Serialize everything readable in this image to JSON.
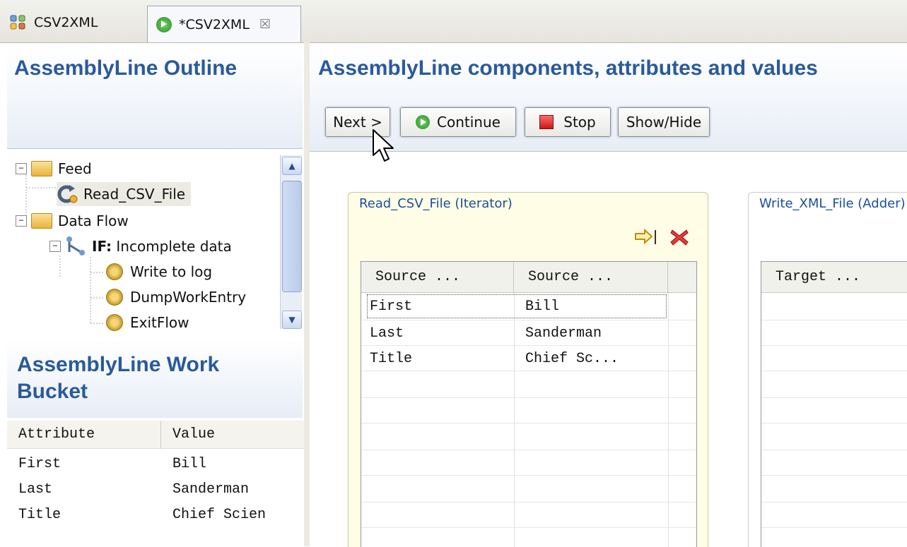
{
  "tabs": [
    {
      "label": "CSV2XML",
      "icon": "components-icon"
    },
    {
      "label": "*CSV2XML",
      "icon": "run-icon",
      "close": "☒"
    }
  ],
  "outline": {
    "title": "AssemblyLine Outline",
    "tree": {
      "feed": {
        "label": "Feed",
        "expander": "−"
      },
      "read_csv": {
        "label": "Read_CSV_File"
      },
      "dataflow": {
        "label": "Data Flow",
        "expander": "−"
      },
      "if_node": {
        "prefix": "IF:",
        "label": " Incomplete data",
        "expander": "−"
      },
      "write_log": {
        "label": "Write to log"
      },
      "dump": {
        "label": "DumpWorkEntry"
      },
      "exit": {
        "label": "ExitFlow"
      }
    }
  },
  "bucket": {
    "title": "AssemblyLine Work Bucket",
    "headers": [
      "Attribute",
      "Value"
    ],
    "rows": [
      [
        "First",
        "Bill"
      ],
      [
        "Last",
        "Sanderman"
      ],
      [
        "Title",
        "Chief Scien"
      ]
    ]
  },
  "main": {
    "title": "AssemblyLine components, attributes and values",
    "buttons": {
      "next": "Next >",
      "continue": "Continue",
      "stop": "Stop",
      "showhide": "Show/Hide"
    }
  },
  "components": [
    {
      "label": "Read_CSV_File (Iterator)",
      "headers": [
        "Source ...",
        "Source ..."
      ],
      "rows": [
        [
          "First",
          "Bill"
        ],
        [
          "Last",
          "Sanderman"
        ],
        [
          "Title",
          "Chief Sc..."
        ]
      ]
    },
    {
      "label": "Write_XML_File (Adder)",
      "headers": [
        "Target ..."
      ],
      "rows": []
    }
  ],
  "colors": {
    "title_blue": "#2a5a9a",
    "label_blue": "#1d4f9a",
    "stop_red": "#c81818",
    "run_green": "#238a25"
  }
}
